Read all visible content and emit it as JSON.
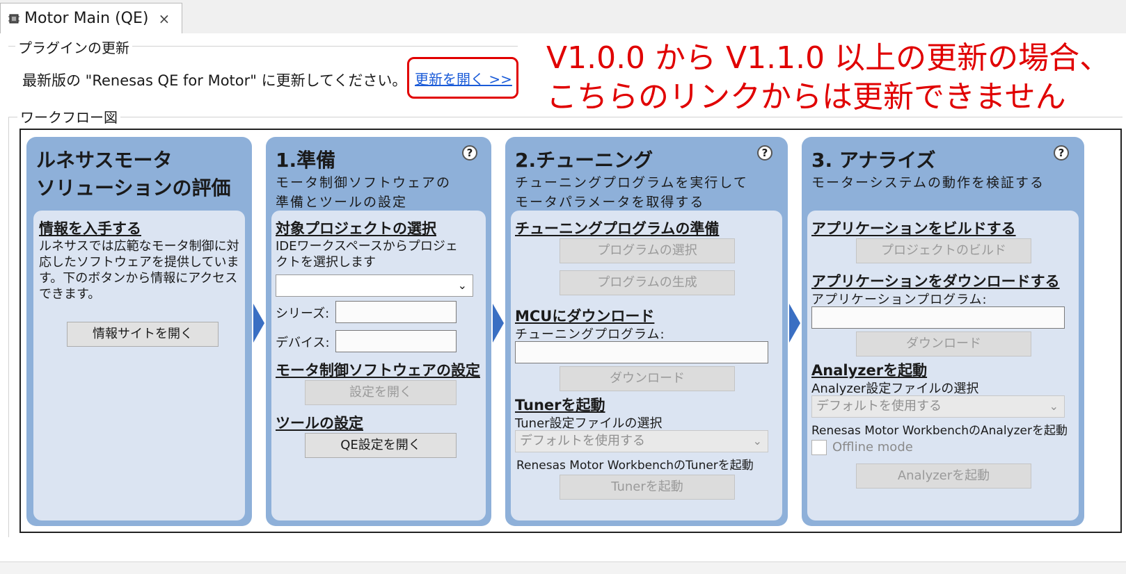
{
  "tab": {
    "label": "Motor Main (QE)",
    "close": "×",
    "icon": "chip-icon"
  },
  "plugin_group": {
    "title": "プラグインの更新",
    "message": "最新版の \"Renesas QE for Motor\" に更新してください。",
    "link": "更新を開く >>"
  },
  "annotation": {
    "line1": "V1.0.0 から V1.1.0 以上の更新の場合、",
    "line2": "こちらのリンクからは更新できません",
    "color": "#e00000"
  },
  "workflow": {
    "title": "ワークフロー図",
    "panel1": {
      "title_line1": "ルネサスモータ",
      "title_line2": "ソリューションの評価",
      "section": "情報を入手する",
      "desc": "ルネサスでは広範なモータ制御に対応したソフトウェアを提供しています。下のボタンから情報にアクセスできます。",
      "button": "情報サイトを開く"
    },
    "panel2": {
      "title": "1.準備",
      "sub1": "モータ制御ソフトウェアの",
      "sub2": "準備とツールの設定",
      "section1": "対象プロジェクトの選択",
      "desc1a": "IDEワークスペースからプロジェ",
      "desc1b": "クトを選択します",
      "series_label": "シリーズ:",
      "device_label": "デバイス:",
      "section2": "モータ制御ソフトウェアの設定",
      "button2": "設定を開く",
      "section3": "ツールの設定",
      "button3": "QE設定を開く"
    },
    "panel3": {
      "title": "2.チューニング",
      "sub1": "チューニングプログラムを実行して",
      "sub2": "モータパラメータを取得する",
      "section1": "チューニングプログラムの準備",
      "btn_select": "プログラムの選択",
      "btn_generate": "プログラムの生成",
      "section2": "MCUにダウンロード",
      "dl_label": "チューニングプログラム:",
      "btn_download": "ダウンロード",
      "section3": "Tunerを起動",
      "tuner_label": "Tuner設定ファイルの選択",
      "tuner_combo": "デフォルトを使用する",
      "rmw_label": "Renesas Motor WorkbenchのTunerを起動",
      "btn_tuner": "Tunerを起動"
    },
    "panel4": {
      "title": "3. アナライズ",
      "sub1": "モーターシステムの動作を検証する",
      "section1": "アプリケーションをビルドする",
      "btn_build": "プロジェクトのビルド",
      "section2": "アプリケーションをダウンロードする",
      "app_label": "アプリケーションプログラム:",
      "btn_download": "ダウンロード",
      "section3": "Analyzerを起動",
      "analyzer_label": "Analyzer設定ファイルの選択",
      "analyzer_combo": "デフォルトを使用する",
      "rmw_label": "Renesas Motor WorkbenchのAnalyzerを起動",
      "offline": "Offline mode",
      "btn_analyzer": "Analyzerを起動"
    },
    "help_glyph": "?",
    "combo_arrow": "⌄"
  }
}
